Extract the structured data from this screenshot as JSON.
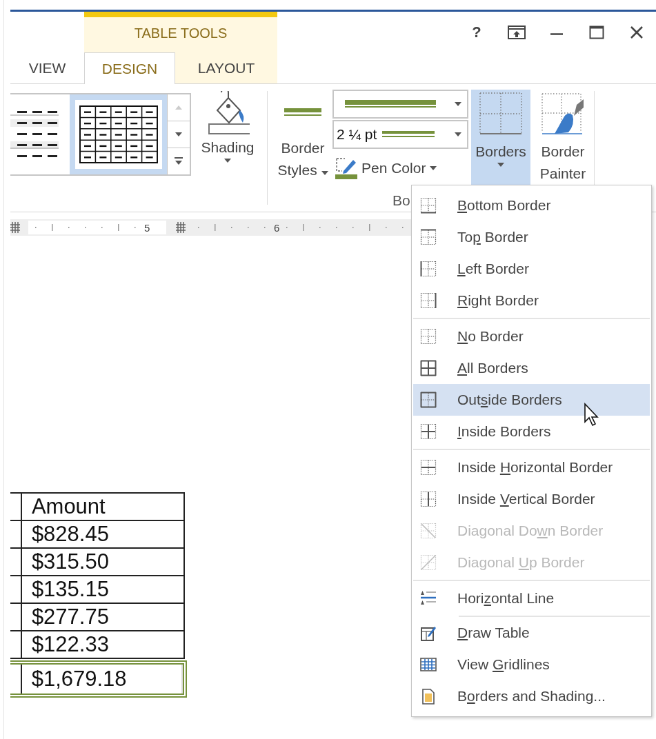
{
  "window": {
    "help": "?"
  },
  "contextual_group": {
    "label": "TABLE TOOLS"
  },
  "tabs": [
    {
      "label": "VIEW",
      "selected": false,
      "contextual": false
    },
    {
      "label": "DESIGN",
      "selected": true,
      "contextual": true
    },
    {
      "label": "LAYOUT",
      "selected": false,
      "contextual": true
    }
  ],
  "ribbon": {
    "gallery": {
      "styles": [
        {
          "selected": false
        },
        {
          "selected": true
        }
      ]
    },
    "shading": {
      "label": "Shading"
    },
    "border_styles": {
      "label_lines": [
        "Border",
        "Styles"
      ]
    },
    "line_weight": {
      "value": "2 ¼ pt"
    },
    "pen_color": {
      "label": "Pen Color"
    },
    "borders": {
      "label": "Borders",
      "selected": true
    },
    "border_painter": {
      "label_lines": [
        "Border",
        "Painter"
      ]
    },
    "group_label": "Bo"
  },
  "ruler": {
    "labels": [
      "5",
      "6"
    ]
  },
  "table": {
    "rows": [
      {
        "kind": "header",
        "text": "Amount"
      },
      {
        "kind": "data",
        "text": "$828.45"
      },
      {
        "kind": "data",
        "text": "$315.50"
      },
      {
        "kind": "data",
        "text": "$135.15"
      },
      {
        "kind": "data",
        "text": "$277.75"
      },
      {
        "kind": "data",
        "text": "$122.33"
      },
      {
        "kind": "total",
        "text": "$1,679.18"
      }
    ]
  },
  "menu": {
    "groups": [
      [
        {
          "key": "B",
          "post": "ottom Border",
          "selected": false,
          "disabled": false
        },
        {
          "pre": "To",
          "key": "p",
          "post": " Border",
          "selected": false,
          "disabled": false
        },
        {
          "key": "L",
          "post": "eft Border",
          "selected": false,
          "disabled": false
        },
        {
          "key": "R",
          "post": "ight Border",
          "selected": false,
          "disabled": false
        }
      ],
      [
        {
          "key": "N",
          "post": "o Border",
          "selected": false,
          "disabled": false
        },
        {
          "key": "A",
          "post": "ll Borders",
          "selected": false,
          "disabled": false
        },
        {
          "pre": "Out",
          "key": "s",
          "post": "ide Borders",
          "selected": true,
          "disabled": false
        },
        {
          "key": "I",
          "post": "nside Borders",
          "selected": false,
          "disabled": false
        }
      ],
      [
        {
          "pre": "Inside ",
          "key": "H",
          "post": "orizontal Border",
          "selected": false,
          "disabled": false
        },
        {
          "pre": "Inside ",
          "key": "V",
          "post": "ertical Border",
          "selected": false,
          "disabled": false
        },
        {
          "pre": "Diagonal Do",
          "key": "w",
          "post": "n Border",
          "selected": false,
          "disabled": true
        },
        {
          "pre": "Diagonal ",
          "key": "U",
          "post": "p Border",
          "selected": false,
          "disabled": true
        }
      ],
      [
        {
          "pre": "Hori",
          "key": "z",
          "post": "ontal Line",
          "selected": false,
          "disabled": false
        }
      ],
      [
        {
          "key": "D",
          "post": "raw Table",
          "selected": false,
          "disabled": false
        },
        {
          "pre": "View ",
          "key": "G",
          "post": "ridlines",
          "selected": false,
          "disabled": false
        },
        {
          "pre": "B",
          "key": "o",
          "post": "rders and Shading...",
          "selected": false,
          "disabled": false
        }
      ]
    ]
  }
}
